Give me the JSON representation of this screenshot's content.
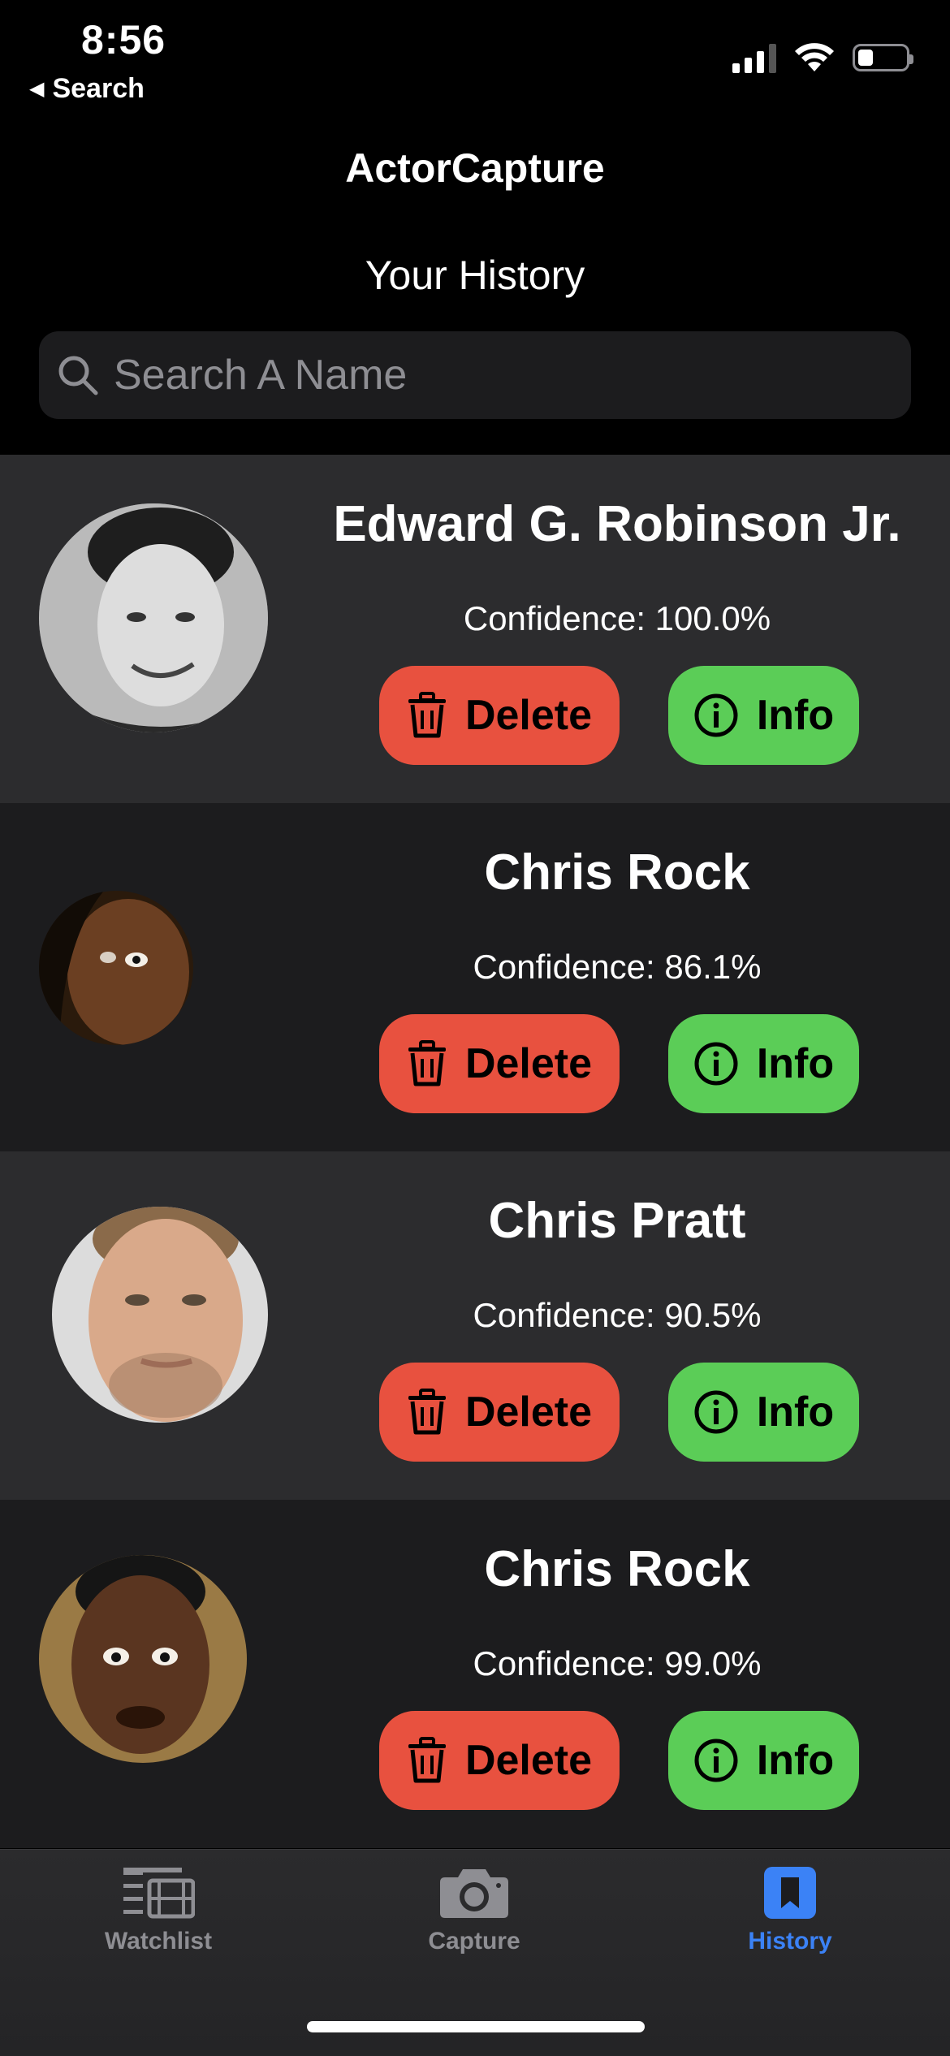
{
  "status_bar": {
    "time": "8:56",
    "back_label": "Search"
  },
  "header": {
    "app_title": "ActorCapture",
    "section_title": "Your History"
  },
  "search": {
    "placeholder": "Search A Name",
    "value": ""
  },
  "history": [
    {
      "name": "Edward G. Robinson Jr.",
      "confidence": "Confidence: 100.0%",
      "delete_label": "Delete",
      "info_label": "Info"
    },
    {
      "name": "Chris Rock",
      "confidence": "Confidence: 86.1%",
      "delete_label": "Delete",
      "info_label": "Info"
    },
    {
      "name": "Chris Pratt",
      "confidence": "Confidence: 90.5%",
      "delete_label": "Delete",
      "info_label": "Info"
    },
    {
      "name": "Chris Rock",
      "confidence": "Confidence: 99.0%",
      "delete_label": "Delete",
      "info_label": "Info"
    }
  ],
  "tabs": [
    {
      "label": "Watchlist",
      "icon": "film-list-icon",
      "active": false
    },
    {
      "label": "Capture",
      "icon": "camera-icon",
      "active": false
    },
    {
      "label": "History",
      "icon": "bookmark-icon",
      "active": true
    }
  ],
  "colors": {
    "delete": "#e8513f",
    "info": "#5bcd57",
    "active_tab": "#3b82f6",
    "row_light": "#2c2c2e",
    "row_dark": "#1c1c1e"
  }
}
